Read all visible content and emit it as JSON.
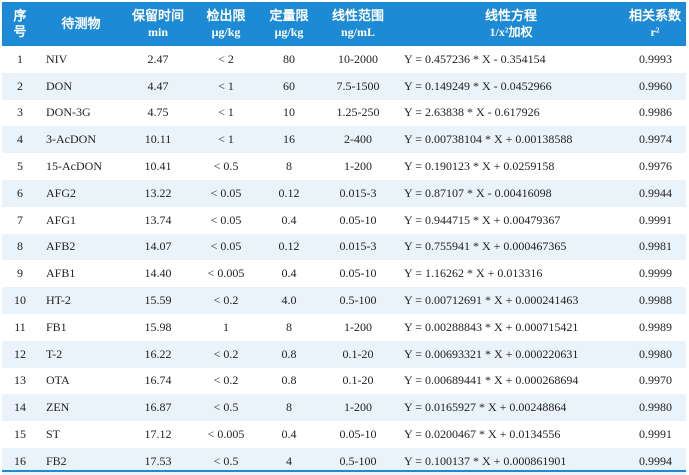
{
  "table": {
    "headers": [
      {
        "line1": "序",
        "line2": "号"
      },
      {
        "line1": "待测物",
        "line2": ""
      },
      {
        "line1": "保留时间",
        "line2": "min"
      },
      {
        "line1": "检出限",
        "line2": "μg/kg"
      },
      {
        "line1": "定量限",
        "line2": "μg/kg"
      },
      {
        "line1": "线性范围",
        "line2": "ng/mL"
      },
      {
        "line1": "线性方程",
        "line2": "1/x²加权"
      },
      {
        "line1": "相关系数",
        "line2": "r²"
      }
    ],
    "rows": [
      [
        "1",
        "NIV",
        "2.47",
        "< 2",
        "80",
        "10-2000",
        "Y = 0.457236 * X - 0.354154",
        "0.9993"
      ],
      [
        "2",
        "DON",
        "4.47",
        "< 1",
        "60",
        "7.5-1500",
        "Y = 0.149249 * X - 0.0452966",
        "0.9960"
      ],
      [
        "3",
        "DON-3G",
        "4.75",
        "< 1",
        "10",
        "1.25-250",
        "Y = 2.63838 * X - 0.617926",
        "0.9986"
      ],
      [
        "4",
        "3-AcDON",
        "10.11",
        "< 1",
        "16",
        "2-400",
        "Y = 0.00738104 * X + 0.00138588",
        "0.9974"
      ],
      [
        "5",
        "15-AcDON",
        "10.41",
        "< 0.5",
        "8",
        "1-200",
        "Y = 0.190123 * X + 0.0259158",
        "0.9976"
      ],
      [
        "6",
        "AFG2",
        "13.22",
        "< 0.05",
        "0.12",
        "0.015-3",
        "Y = 0.87107 * X - 0.00416098",
        "0.9944"
      ],
      [
        "7",
        "AFG1",
        "13.74",
        "< 0.05",
        "0.4",
        "0.05-10",
        "Y = 0.944715 * X + 0.00479367",
        "0.9991"
      ],
      [
        "8",
        "AFB2",
        "14.07",
        "< 0.05",
        "0.12",
        "0.015-3",
        "Y = 0.755941 * X + 0.000467365",
        "0.9981"
      ],
      [
        "9",
        "AFB1",
        "14.40",
        "< 0.005",
        "0.4",
        "0.05-10",
        "Y = 1.16262 * X + 0.013316",
        "0.9999"
      ],
      [
        "10",
        "HT-2",
        "15.59",
        "< 0.2",
        "4.0",
        "0.5-100",
        "Y = 0.00712691 * X + 0.000241463",
        "0.9988"
      ],
      [
        "11",
        "FB1",
        "15.98",
        "1",
        "8",
        "1-200",
        "Y = 0.00288843 * X + 0.000715421",
        "0.9989"
      ],
      [
        "12",
        "T-2",
        "16.22",
        "< 0.2",
        "0.8",
        "0.1-20",
        "Y = 0.00693321 * X + 0.000220631",
        "0.9980"
      ],
      [
        "13",
        "OTA",
        "16.74",
        "< 0.2",
        "0.8",
        "0.1-20",
        "Y = 0.00689441 * X + 0.000268694",
        "0.9970"
      ],
      [
        "14",
        "ZEN",
        "16.87",
        "< 0.5",
        "8",
        "1-200",
        "Y = 0.0165927 * X + 0.00248864",
        "0.9980"
      ],
      [
        "15",
        "ST",
        "17.12",
        "< 0.005",
        "0.4",
        "0.05-10",
        "Y = 0.0200467 * X + 0.0134556",
        "0.9991"
      ],
      [
        "16",
        "FB2",
        "17.53",
        "< 0.5",
        "4",
        "0.5-100",
        "Y = 0.100137 * X + 0.000861901",
        "0.9994"
      ]
    ]
  },
  "colors": {
    "header_bg": "#1d8ad6",
    "header_text": "#ffffff",
    "stripe": "#eaf2fa"
  }
}
